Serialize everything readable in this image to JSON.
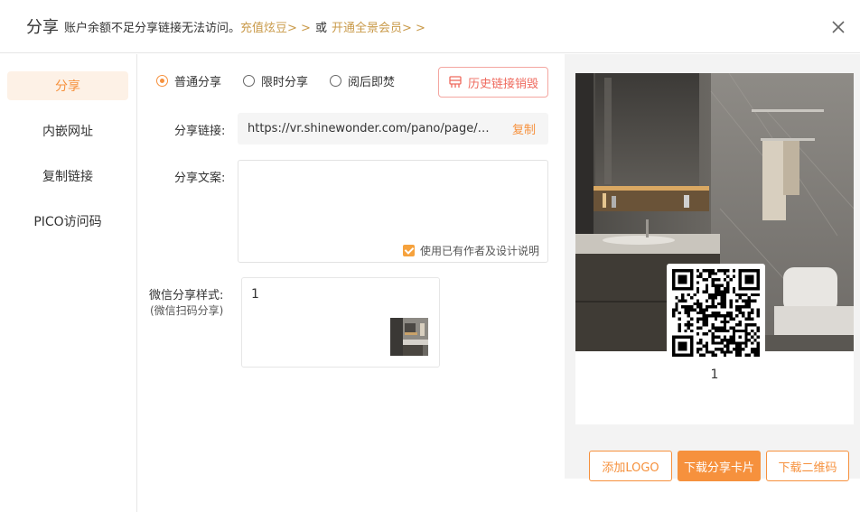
{
  "header": {
    "title": "分享",
    "notice": "账户余额不足分享链接无法访问。",
    "recharge_link": "充值炫豆> >",
    "or_text": "或",
    "vip_link": "开通全景会员> >"
  },
  "sidebar": {
    "items": [
      {
        "label": "分享",
        "active": true
      },
      {
        "label": "内嵌网址",
        "active": false
      },
      {
        "label": "复制链接",
        "active": false
      },
      {
        "label": "PICO访问码",
        "active": false
      }
    ]
  },
  "share_mode": {
    "options": [
      {
        "label": "普通分享",
        "checked": true
      },
      {
        "label": "限时分享",
        "checked": false
      },
      {
        "label": "阅后即焚",
        "checked": false
      }
    ],
    "history_button": "历史链接销毁"
  },
  "share_link": {
    "label": "分享链接:",
    "url": "https://vr.shinewonder.com/pano/page/pu...",
    "copy_label": "复制"
  },
  "share_text": {
    "label": "分享文案:",
    "value": "",
    "checkbox_label": "使用已有作者及设计说明",
    "checkbox_checked": true
  },
  "wechat_style": {
    "label": "微信分享样式:",
    "sub_label": "(微信扫码分享)",
    "card_title": "1"
  },
  "preview": {
    "caption": "1"
  },
  "buttons": {
    "add_logo": "添加LOGO",
    "download_card": "下载分享卡片",
    "download_qr": "下载二维码"
  },
  "colors": {
    "accent": "#f6913d",
    "gold_link": "#c99a4a",
    "danger": "#ef6a5e"
  }
}
